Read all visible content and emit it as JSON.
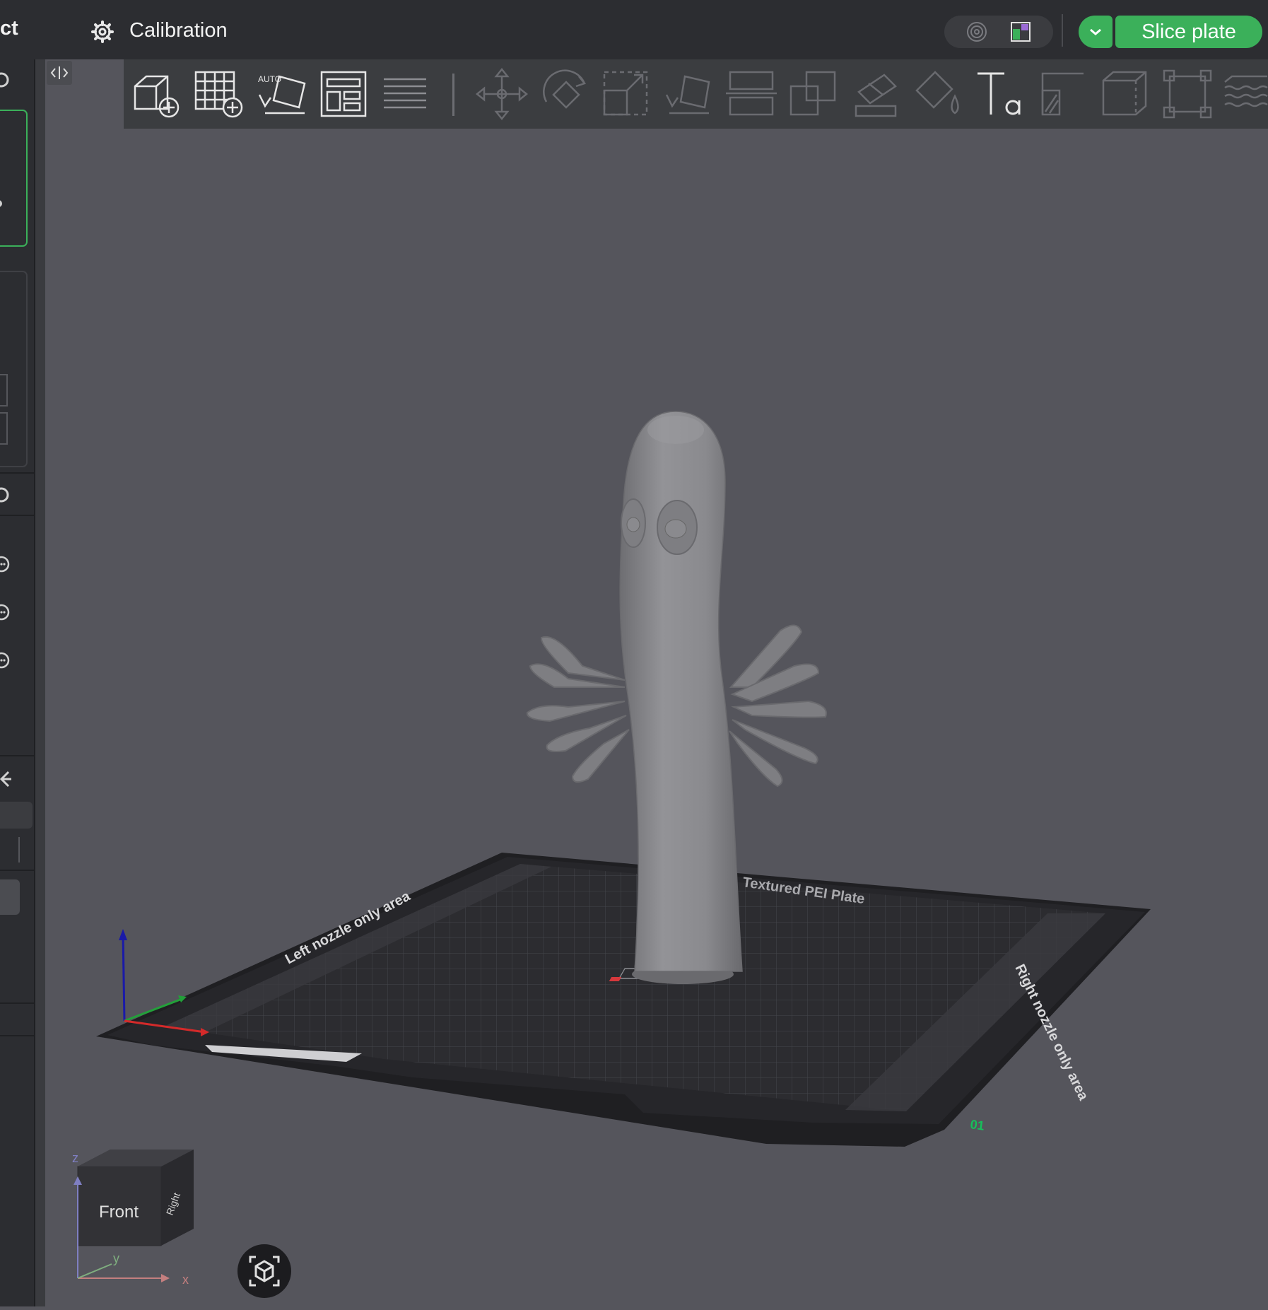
{
  "topbar": {
    "tab_fragment": "ct",
    "tab_title": "Calibration",
    "slice_button": "Slice plate",
    "accent_color": "#3bb05a"
  },
  "icons": [
    "gear-icon",
    "view-3d-icon",
    "layout-icon",
    "chevron-down-icon",
    "add-object-icon",
    "add-plate-icon",
    "auto-orient-icon",
    "arrange-icon",
    "split-layers-icon",
    "move-icon",
    "rotate-icon",
    "scale-icon",
    "lay-on-face-icon",
    "cut-icon",
    "boolean-icon",
    "support-paint-icon",
    "color-paint-icon",
    "text-icon",
    "seam-icon",
    "measure-icon",
    "assembly-icon",
    "fuzzy-skin-icon",
    "snapshot-icon",
    "axis-gizmo-icon"
  ],
  "scene": {
    "bed_label_top": "Textured PEI Plate",
    "bed_label_left": "Left nozzle only area",
    "bed_label_right": "Right nozzle only area",
    "plate_number": "01",
    "toolbar_auto_label": "AUTO"
  },
  "navcube": {
    "front": "Front",
    "right": "Right",
    "axis_x": "x",
    "axis_y": "y",
    "axis_z": "z"
  }
}
